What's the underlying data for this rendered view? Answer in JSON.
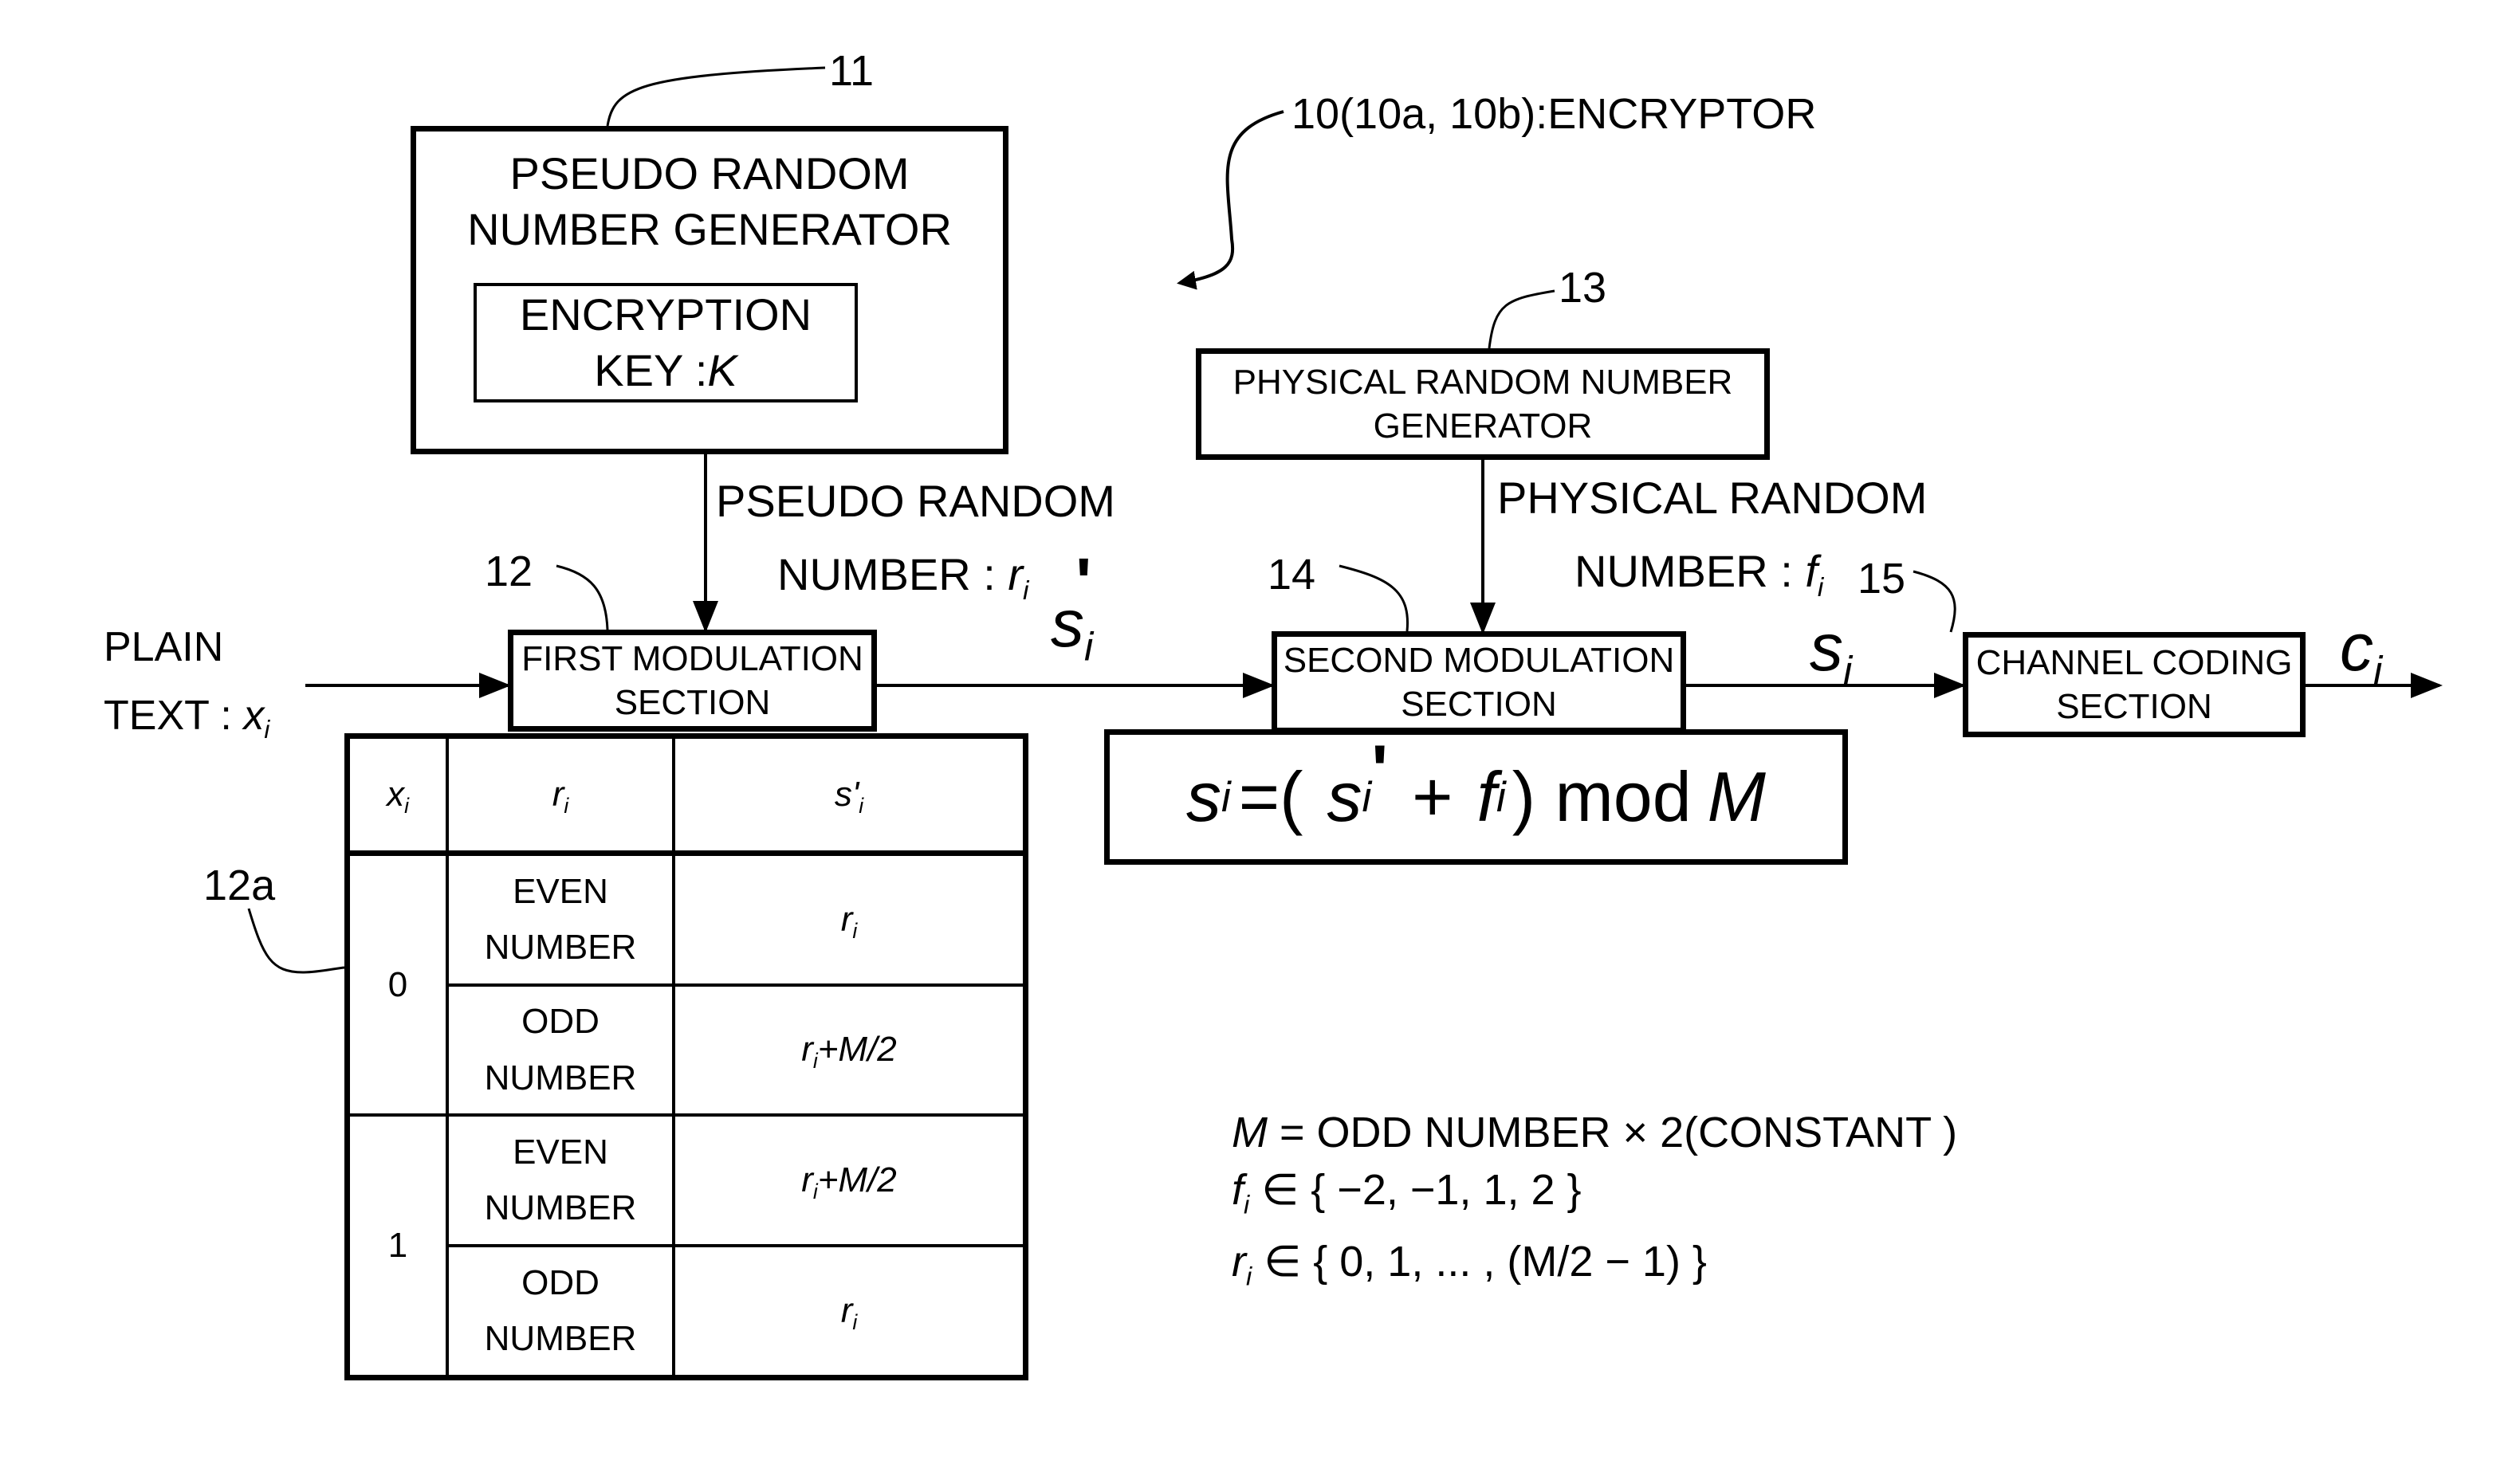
{
  "diagram": {
    "title_ref": "10(10a, 10b):ENCRYPTOR",
    "blocks": {
      "prng": {
        "ref": "11",
        "title_line1": "PSEUDO RANDOM",
        "title_line2": "NUMBER GENERATOR",
        "key_line1": "ENCRYPTION",
        "key_line2_prefix": "KEY :",
        "key_symbol": "K"
      },
      "first_mod": {
        "ref": "12",
        "line1": "FIRST MODULATION",
        "line2": "SECTION"
      },
      "phys_rng": {
        "ref": "13",
        "line1": "PHYSICAL RANDOM NUMBER",
        "line2": "GENERATOR"
      },
      "second_mod": {
        "ref": "14",
        "line1": "SECOND MODULATION",
        "line2": "SECTION"
      },
      "channel_coding": {
        "ref": "15",
        "line1": "CHANNEL CODING",
        "line2": "SECTION"
      }
    },
    "signals": {
      "plain_text_line1": "PLAIN",
      "plain_text_line2_prefix": "TEXT :",
      "plain_text_symbol": "x",
      "pseudo_line1": "PSEUDO RANDOM",
      "pseudo_line2_prefix": "NUMBER :",
      "pseudo_symbol": "r",
      "physical_line1": "PHYSICAL RANDOM",
      "physical_line2_prefix": "NUMBER :",
      "physical_symbol": "f",
      "s_prime_symbol": "s",
      "s_symbol": "s",
      "c_symbol": "c",
      "subscript": "i",
      "prime": "'"
    },
    "formula": {
      "lhs": "s",
      "eq": "=(",
      "term1": "s",
      "plus": "+",
      "term2": "f",
      "close": ") mod",
      "modulus": "M"
    },
    "table": {
      "ref": "12a",
      "headers": [
        "x",
        "r",
        "s'"
      ],
      "groups": [
        {
          "x": "0",
          "rows": [
            {
              "r_line1": "EVEN",
              "r_line2": "NUMBER",
              "s": "r",
              "s_suffix": ""
            },
            {
              "r_line1": "ODD",
              "r_line2": "NUMBER",
              "s": "r",
              "s_suffix": "+M/2"
            }
          ]
        },
        {
          "x": "1",
          "rows": [
            {
              "r_line1": "EVEN",
              "r_line2": "NUMBER",
              "s": "r",
              "s_suffix": "+M/2"
            },
            {
              "r_line1": "ODD",
              "r_line2": "NUMBER",
              "s": "r",
              "s_suffix": ""
            }
          ]
        }
      ]
    },
    "constants": {
      "line1_sym": "M",
      "line1_text": " = ODD NUMBER  × 2(CONSTANT )",
      "line2_sym": "f",
      "line2_text": " ∈ { −2, −1, 1, 2 }",
      "line3_sym": "r",
      "line3_text": " ∈ { 0, 1, ... , (M/2 − 1) }"
    }
  }
}
